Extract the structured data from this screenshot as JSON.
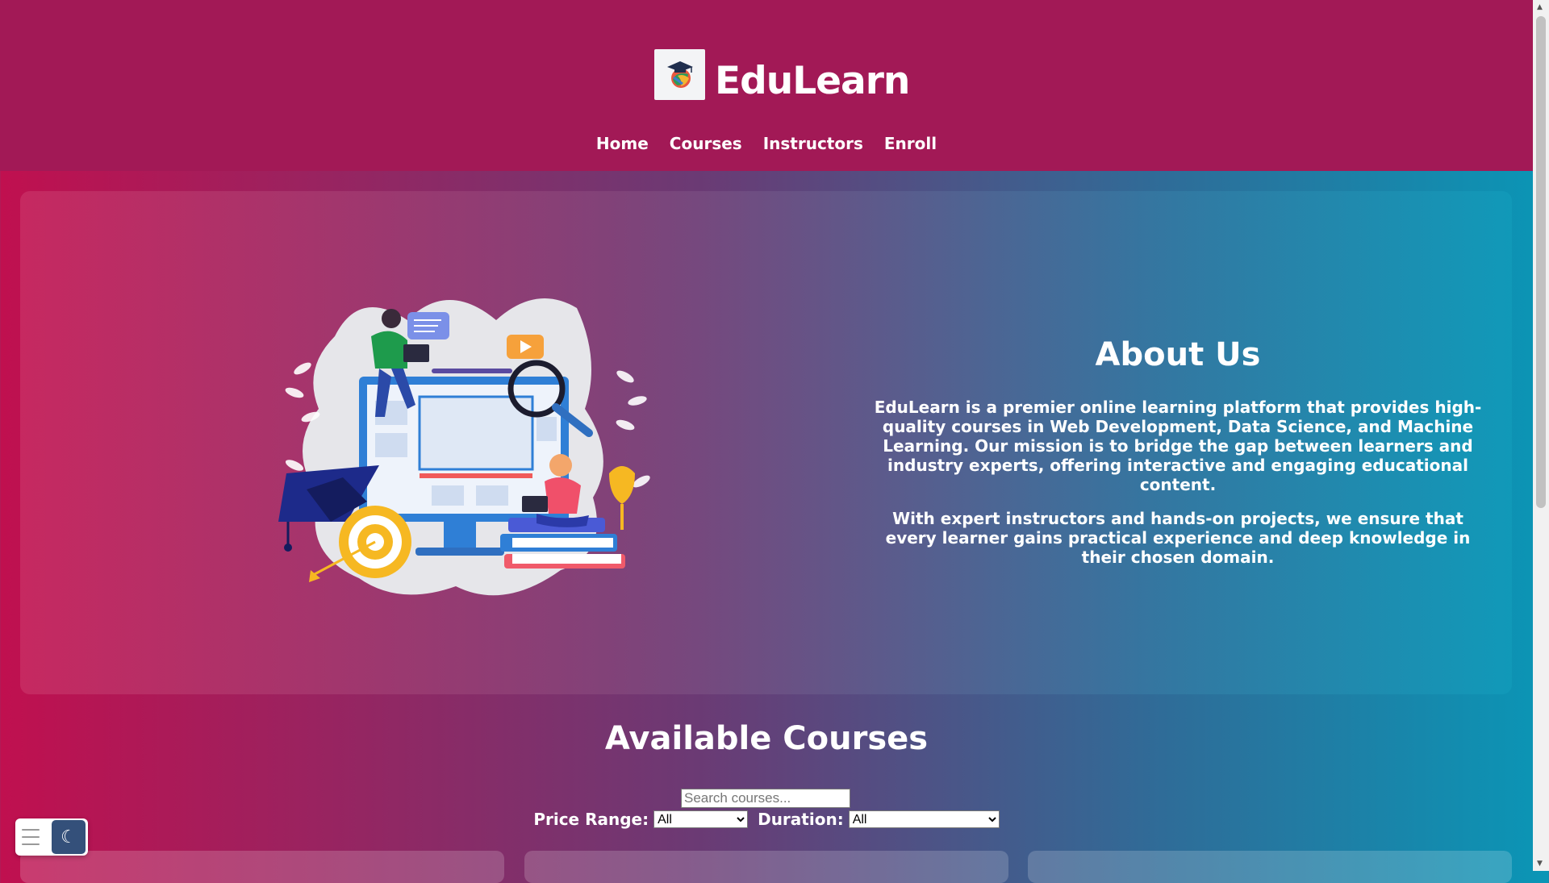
{
  "brand": {
    "name": "EduLearn",
    "logo_icon": "graduation-cap-globe-icon"
  },
  "nav": {
    "items": [
      "Home",
      "Courses",
      "Instructors",
      "Enroll"
    ]
  },
  "about": {
    "title": "About Us",
    "paragraph1": "EduLearn is a premier online learning platform that provides high-quality courses in Web Development, Data Science, and Machine Learning. Our mission is to bridge the gap between learners and industry experts, offering interactive and engaging educational content.",
    "paragraph2": "With expert instructors and hands-on projects, we ensure that every learner gains practical experience and deep knowledge in their chosen domain."
  },
  "courses": {
    "title": "Available Courses",
    "search_placeholder": "Search courses...",
    "price_label": "Price Range:",
    "price_selected": "All",
    "duration_label": "Duration:",
    "duration_selected": "All"
  },
  "controls": {
    "menu_icon": "hamburger-icon",
    "theme_icon": "moon-icon"
  },
  "colors": {
    "header": "#a21956",
    "gradient_start": "#c0104f",
    "gradient_end": "#0a96b6",
    "theme_button": "#34507a"
  }
}
